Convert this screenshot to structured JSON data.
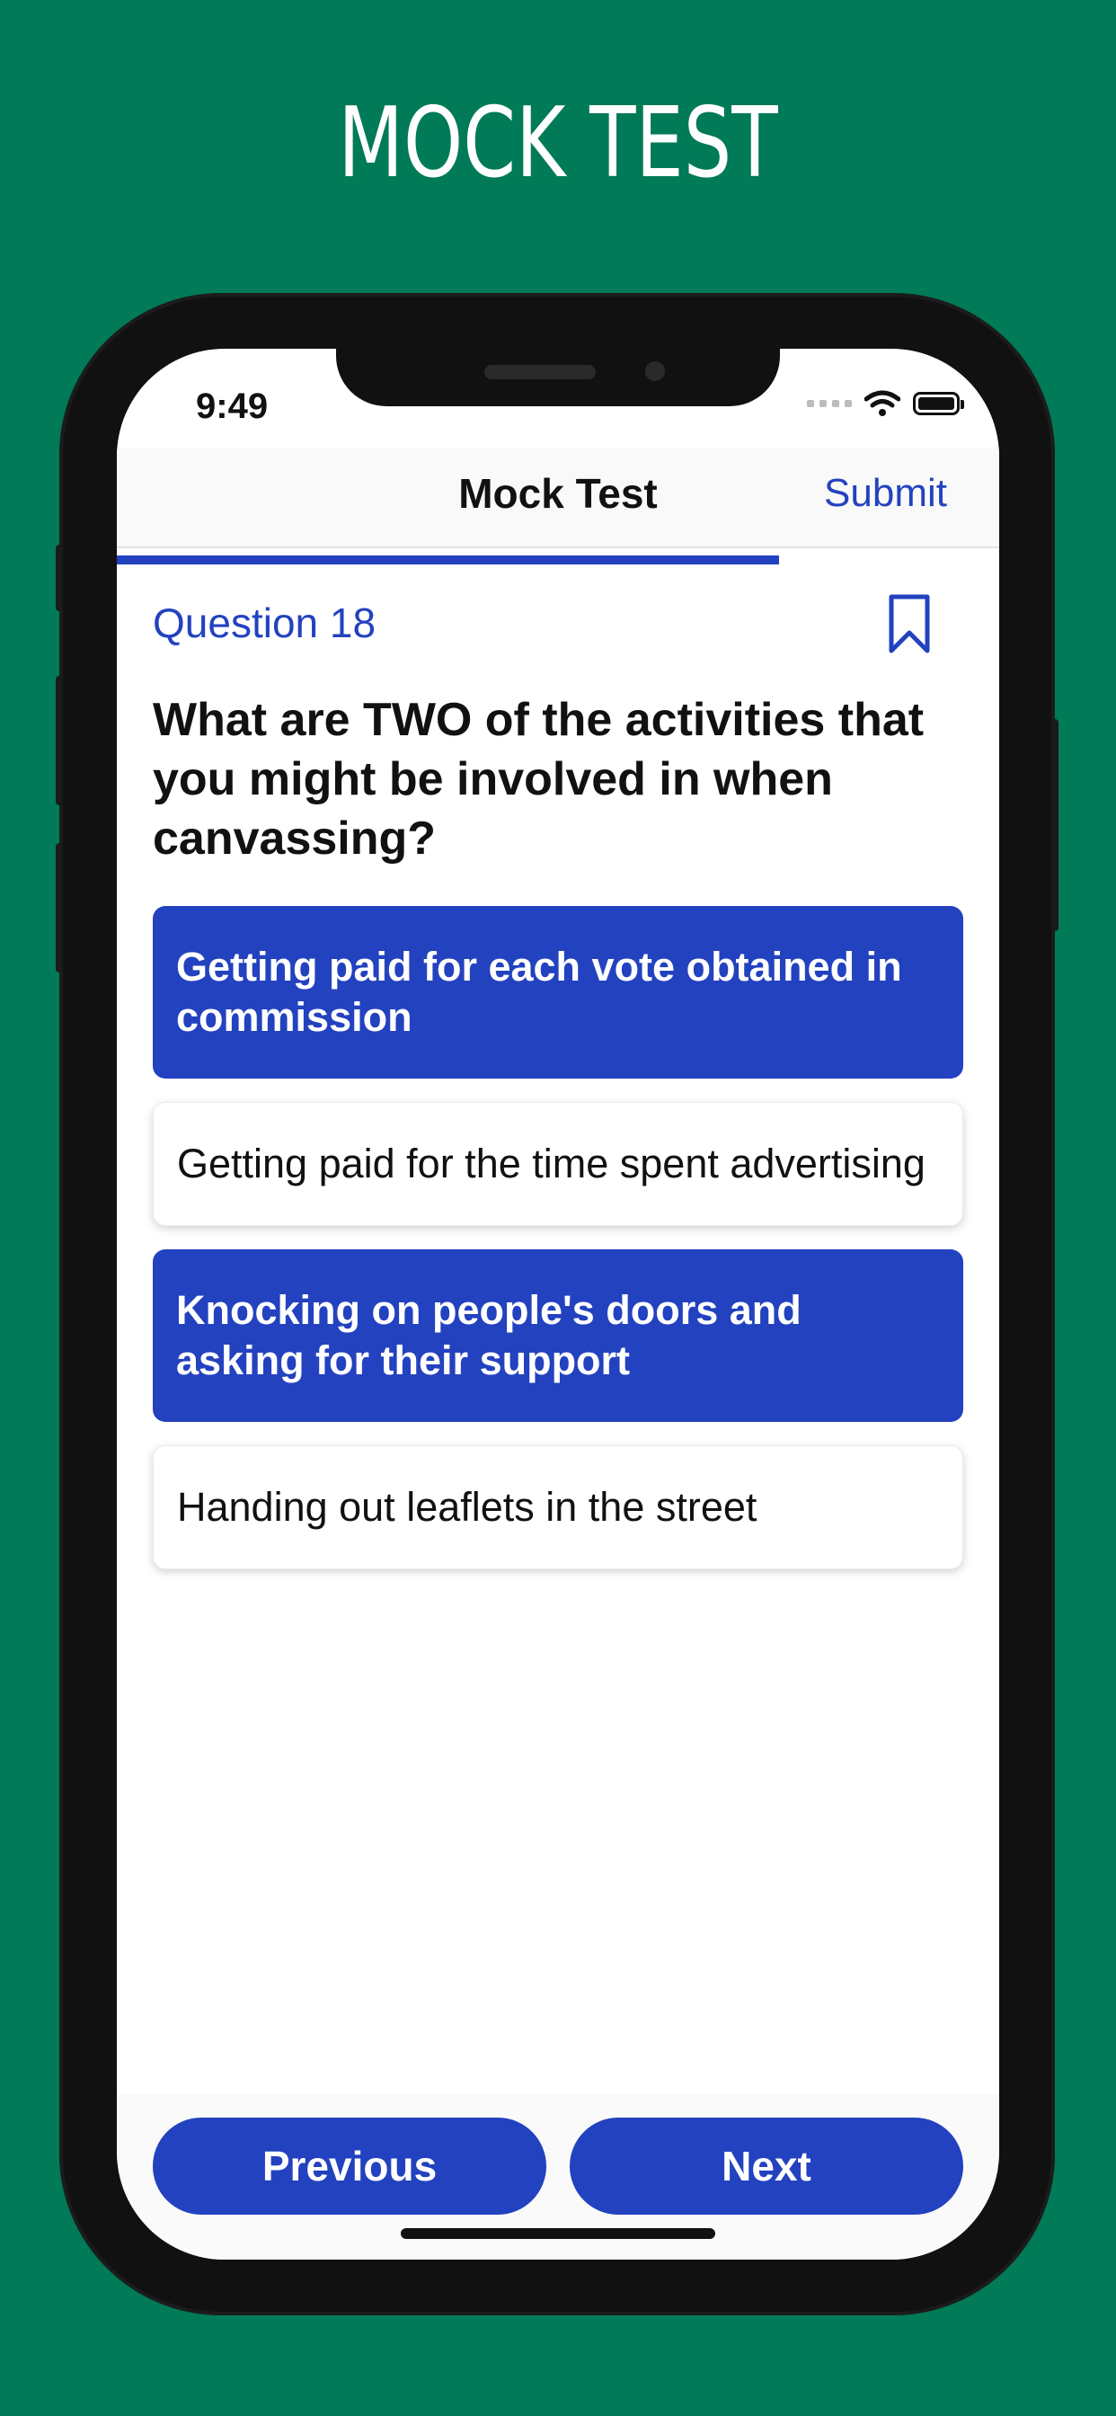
{
  "banner": {
    "title": "MOCK TEST"
  },
  "status_bar": {
    "time": "9:49"
  },
  "nav": {
    "title": "Mock Test",
    "submit_label": "Submit"
  },
  "progress": {
    "fraction": 0.75
  },
  "question": {
    "label": "Question 18",
    "text": "What are TWO of the activities that you might be involved in when canvassing?"
  },
  "options": [
    {
      "text": "Getting paid for each vote obtained in commission",
      "selected": true
    },
    {
      "text": "Getting paid for the time spent advertising",
      "selected": false
    },
    {
      "text": "Knocking on people's doors and asking for their support",
      "selected": true
    },
    {
      "text": "Handing out leaflets in the street",
      "selected": false
    }
  ],
  "buttons": {
    "previous_label": "Previous",
    "next_label": "Next"
  },
  "colors": {
    "background": "#007a57",
    "accent": "#2342bf"
  },
  "icons": {
    "bookmark": "bookmark-icon",
    "wifi": "wifi-icon",
    "battery": "battery-icon"
  }
}
